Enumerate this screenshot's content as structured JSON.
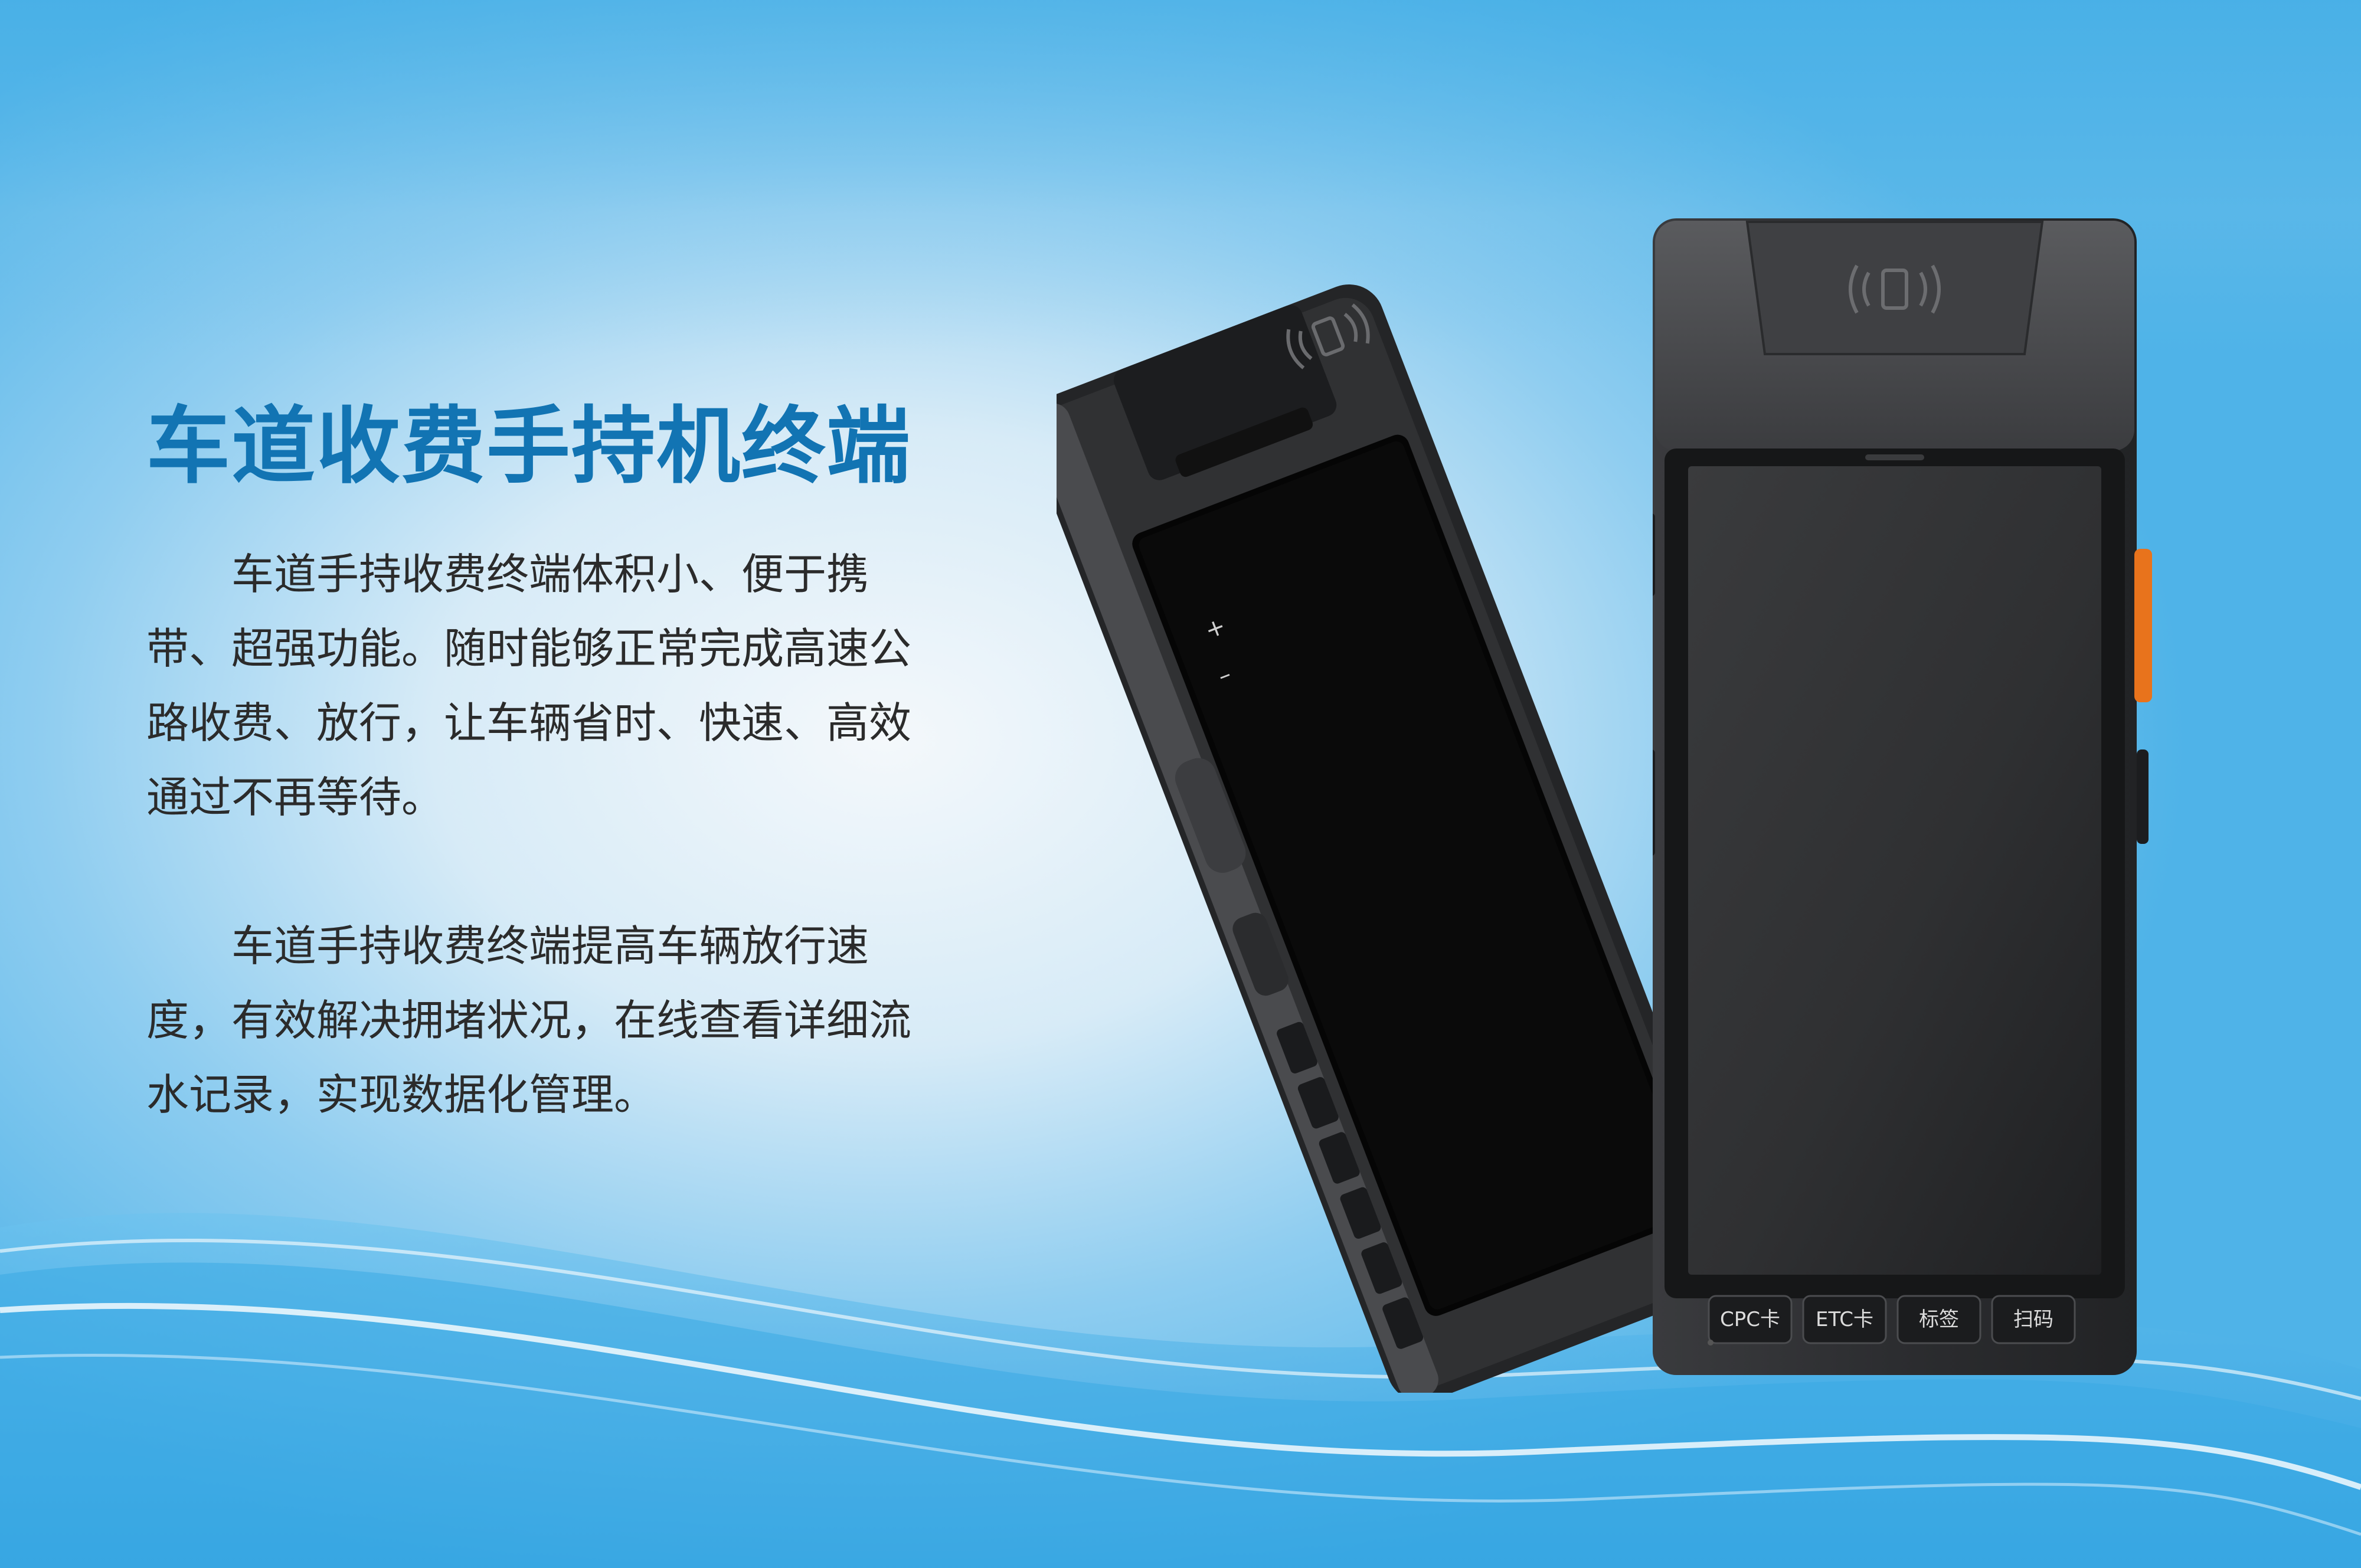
{
  "heading": {
    "title": "车道收费手持机终端"
  },
  "paragraphs": [
    "车道手持收费终端体积小、便于携带、超强功能。随时能够正常完成高速公路收费、放行，让车辆省时、快速、高效通过不再等待。",
    "车道手持收费终端提高车辆放行速度，有效解决拥堵状况，在线查看详细流水记录，实现数据化管理。"
  ],
  "device": {
    "keys": [
      "CPC卡",
      "ETC卡",
      "标签",
      "扫码"
    ],
    "side_buttons": [
      "+",
      "–"
    ],
    "icons": [
      "nfc-contactless-icon"
    ]
  },
  "colors": {
    "title": "#1274b3",
    "body_text": "#2b2b2b",
    "accent_orange": "#e8731c",
    "device_body": "#2a2b2d"
  }
}
